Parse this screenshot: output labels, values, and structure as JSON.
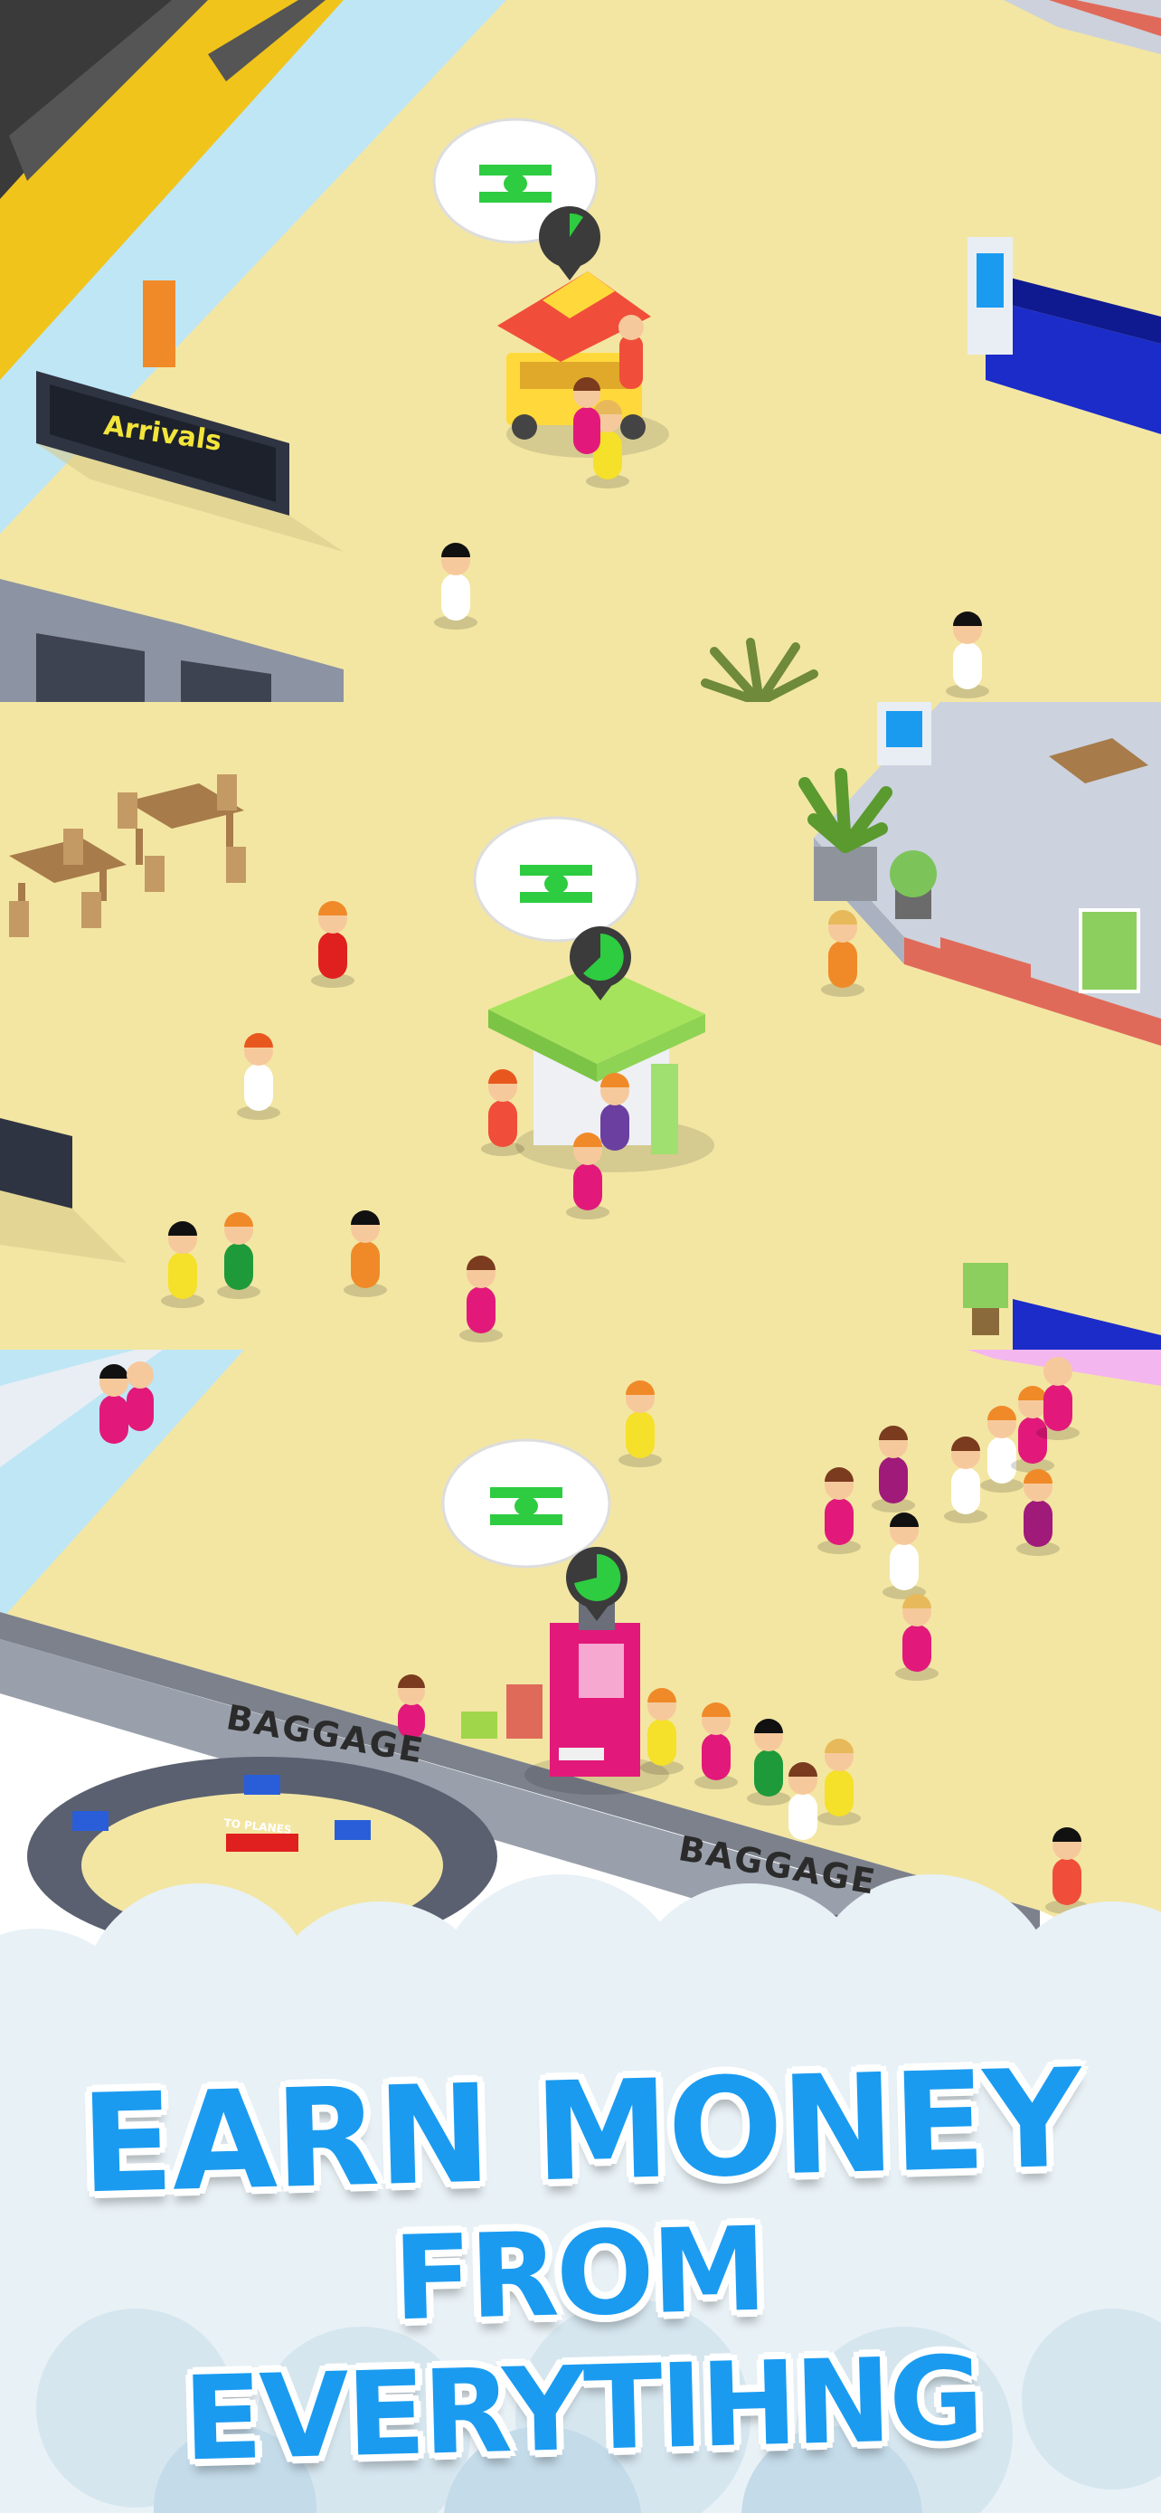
{
  "scene": {
    "arrivals_sign": "Arrivals",
    "baggage_sign_1": "BAGGAGE",
    "baggage_sign_2": "BAGGAGE",
    "to_planes_sign": "TO PLANES"
  },
  "headline": {
    "line1": "EARN MONEY",
    "line2": "FROM EVERYTIHNG"
  },
  "colors": {
    "floor": "#f3e6a3",
    "headline_text": "#1a9bf0",
    "money_green": "#2ecc40",
    "cloud": "#e8f1f6"
  },
  "icons": {
    "money_bubble": "cash-speech-bubble-icon",
    "timer": "timer-pie-icon"
  },
  "progress": {
    "hotdog_stand_timer": 0.15,
    "icecream_stand_timer": 0.6,
    "vending_machine_timer": 0.75
  }
}
